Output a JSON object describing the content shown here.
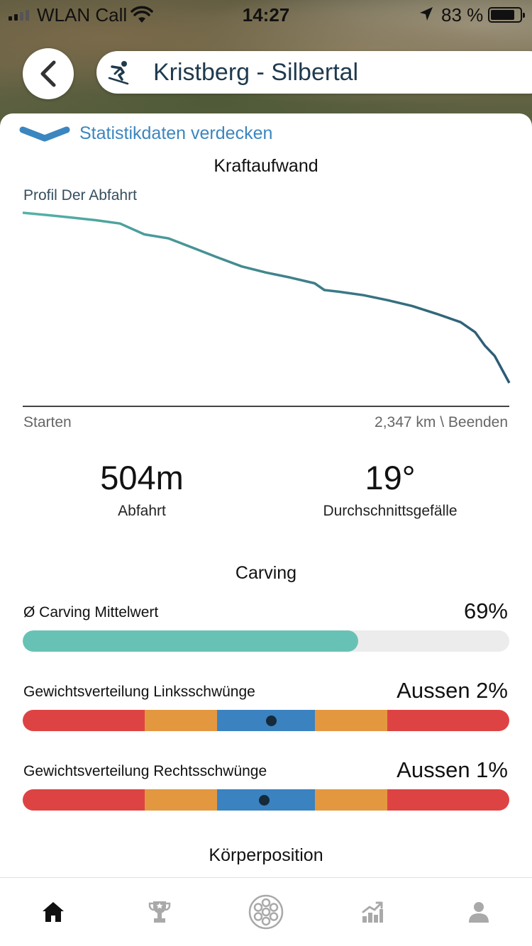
{
  "status_bar": {
    "carrier": "WLAN Call",
    "time": "14:27",
    "battery_percent": "83 %"
  },
  "header": {
    "title": "Kristberg - Silbertal",
    "back_icon": "chevron-left-icon",
    "sport_icon": "skier-icon"
  },
  "toggle": {
    "label": "Statistikdaten verdecken"
  },
  "effort": {
    "title": "Kraftaufwand",
    "profile_label": "Profil Der Abfahrt",
    "start_label": "Starten",
    "end_label": "2,347 km \\ Beenden"
  },
  "chart_data": {
    "type": "line",
    "x": [
      0,
      0.05,
      0.1,
      0.15,
      0.2,
      0.25,
      0.3,
      0.35,
      0.4,
      0.45,
      0.5,
      0.55,
      0.6,
      0.62,
      0.65,
      0.7,
      0.75,
      0.8,
      0.85,
      0.9,
      0.93,
      0.95,
      0.97,
      1.0
    ],
    "y": [
      504,
      497,
      490,
      482,
      472,
      440,
      428,
      400,
      372,
      345,
      327,
      312,
      295,
      275,
      270,
      260,
      245,
      228,
      205,
      180,
      150,
      110,
      80,
      0
    ],
    "xlabel": "",
    "ylabel": "",
    "grid": false
  },
  "stats": [
    {
      "value": "504m",
      "label": "Abfahrt"
    },
    {
      "value": "19°",
      "label": "Durchschnittsgefälle"
    }
  ],
  "carving": {
    "title": "Carving",
    "avg_label": "Ø Carving Mittelwert",
    "avg_value": "69%",
    "avg_fraction": 0.69,
    "left_label": "Gewichtsverteilung Linksschwünge",
    "left_value": "Aussen 2%",
    "left_marker": 0.51,
    "right_label": "Gewichtsverteilung Rechtsschwünge",
    "right_value": "Aussen 1%",
    "right_marker": 0.495,
    "segment_colors": [
      "#de4343",
      "#e39840",
      "#3b82c0",
      "#e39840",
      "#de4343"
    ],
    "segment_widths": [
      0.25,
      0.15,
      0.2,
      0.15,
      0.25
    ]
  },
  "body_position": {
    "title": "Körperposition"
  },
  "tab_bar": {
    "items": [
      {
        "icon": "home-icon",
        "active": true
      },
      {
        "icon": "trophy-icon",
        "active": false
      },
      {
        "icon": "carv-logo-icon",
        "active": false
      },
      {
        "icon": "stats-icon",
        "active": false
      },
      {
        "icon": "profile-icon",
        "active": false
      }
    ]
  },
  "colors": {
    "accent_blue": "#3b86bf",
    "title_navy": "#1f3a4d",
    "teal": "#67c2b5"
  }
}
